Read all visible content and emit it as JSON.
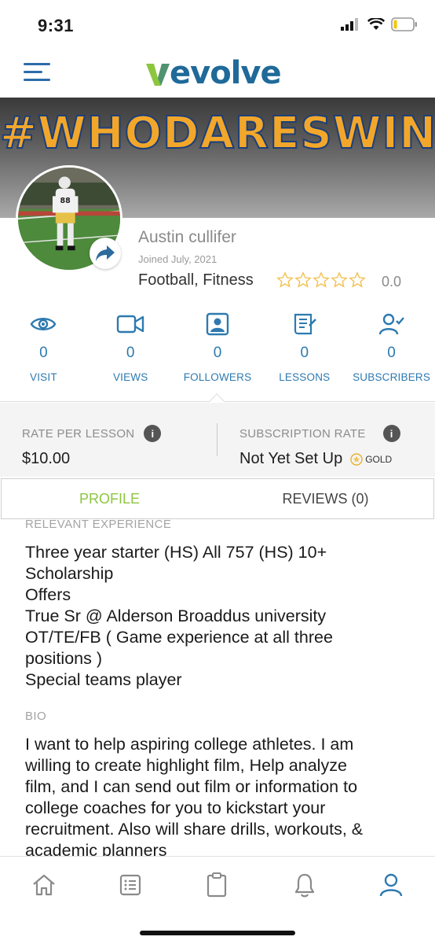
{
  "status_bar": {
    "time": "9:31"
  },
  "header": {
    "logo": "evolve"
  },
  "banner": {
    "text": "#WHODARESWINS"
  },
  "profile": {
    "name": "Austin cullifer",
    "joined": "Joined July, 2021",
    "sports": "Football, Fitness",
    "rating": "0.0",
    "star_count": 5
  },
  "stats": [
    {
      "icon": "eye-icon",
      "value": "0",
      "label": "VISIT"
    },
    {
      "icon": "video-camera-icon",
      "value": "0",
      "label": "VIEWS"
    },
    {
      "icon": "user-portrait-icon",
      "value": "0",
      "label": "FOLLOWERS"
    },
    {
      "icon": "lessons-doc-icon",
      "value": "0",
      "label": "LESSONS"
    },
    {
      "icon": "user-check-icon",
      "value": "0",
      "label": "SUBSCRIBERS"
    }
  ],
  "rates": {
    "per_lesson_title": "RATE PER LESSON",
    "per_lesson_value": "$10.00",
    "subscription_title": "SUBSCRIPTION RATE",
    "subscription_value": "Not Yet Set Up",
    "tier": "GOLD"
  },
  "tabs": {
    "profile": "PROFILE",
    "reviews": "REVIEWS (0)",
    "active": "profile"
  },
  "content": {
    "experience_label": "RELEVANT EXPERIENCE",
    "experience_text": "Three year starter (HS) All 757 (HS) 10+\nScholarship\nOffers\nTrue Sr @ Alderson Broaddus university\nOT/TE/FB ( Game experience at all three\npositions )\nSpecial teams player",
    "bio_label": "BIO",
    "bio_text": "I want to help aspiring college athletes. I am\nwilling to create highlight film, Help analyze\nfilm, and I can send out film or information to\ncollege coaches for you to kickstart your\nrecruitment. Also will share drills, workouts, &\nacademic planners"
  },
  "bottom_nav": [
    {
      "icon": "home-icon",
      "active": false
    },
    {
      "icon": "list-icon",
      "active": false
    },
    {
      "icon": "clipboard-icon",
      "active": false
    },
    {
      "icon": "bell-icon",
      "active": false
    },
    {
      "icon": "profile-icon",
      "active": true
    }
  ],
  "colors": {
    "brand_blue": "#2d7ab0",
    "brand_green": "#8cc63f",
    "banner_gold": "#f2a72b",
    "star": "#f2c14e"
  }
}
